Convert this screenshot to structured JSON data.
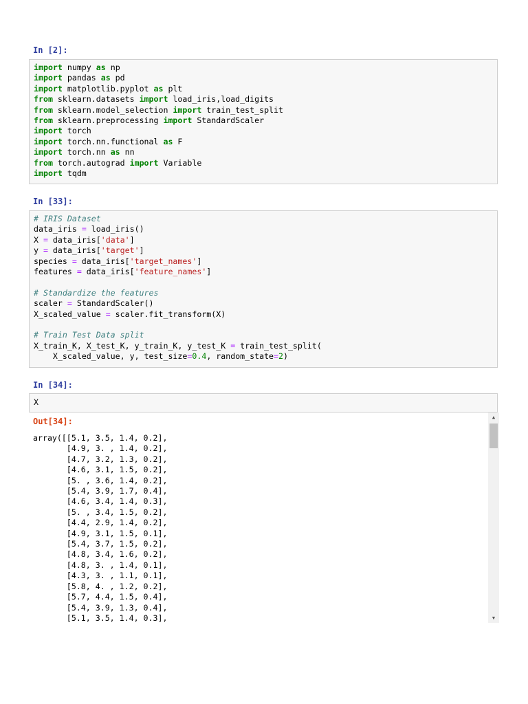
{
  "cells": [
    {
      "prompt": "In [2]:",
      "lines": [
        [
          {
            "t": "import",
            "c": "kw"
          },
          {
            "t": " numpy "
          },
          {
            "t": "as",
            "c": "kw"
          },
          {
            "t": " np"
          }
        ],
        [
          {
            "t": "import",
            "c": "kw"
          },
          {
            "t": " pandas "
          },
          {
            "t": "as",
            "c": "kw"
          },
          {
            "t": " pd"
          }
        ],
        [
          {
            "t": "import",
            "c": "kw"
          },
          {
            "t": " matplotlib.pyplot "
          },
          {
            "t": "as",
            "c": "kw"
          },
          {
            "t": " plt"
          }
        ],
        [
          {
            "t": "from",
            "c": "kw"
          },
          {
            "t": " sklearn.datasets "
          },
          {
            "t": "import",
            "c": "kw"
          },
          {
            "t": " load_iris,load_digits"
          }
        ],
        [
          {
            "t": "from",
            "c": "kw"
          },
          {
            "t": " sklearn.model_selection "
          },
          {
            "t": "import",
            "c": "kw"
          },
          {
            "t": " train_test_split"
          }
        ],
        [
          {
            "t": "from",
            "c": "kw"
          },
          {
            "t": " sklearn.preprocessing "
          },
          {
            "t": "import",
            "c": "kw"
          },
          {
            "t": " StandardScaler"
          }
        ],
        [
          {
            "t": "import",
            "c": "kw"
          },
          {
            "t": " torch"
          }
        ],
        [
          {
            "t": "import",
            "c": "kw"
          },
          {
            "t": " torch.nn.functional "
          },
          {
            "t": "as",
            "c": "kw"
          },
          {
            "t": " F"
          }
        ],
        [
          {
            "t": "import",
            "c": "kw"
          },
          {
            "t": " torch.nn "
          },
          {
            "t": "as",
            "c": "kw"
          },
          {
            "t": " nn"
          }
        ],
        [
          {
            "t": "from",
            "c": "kw"
          },
          {
            "t": " torch.autograd "
          },
          {
            "t": "import",
            "c": "kw"
          },
          {
            "t": " Variable"
          }
        ],
        [
          {
            "t": "import",
            "c": "kw"
          },
          {
            "t": " tqdm"
          }
        ]
      ]
    },
    {
      "prompt": "In [33]:",
      "lines": [
        [
          {
            "t": "# IRIS Dataset",
            "c": "cm"
          }
        ],
        [
          {
            "t": "data_iris "
          },
          {
            "t": "=",
            "c": "op"
          },
          {
            "t": " load_iris()"
          }
        ],
        [
          {
            "t": "X "
          },
          {
            "t": "=",
            "c": "op"
          },
          {
            "t": " data_iris["
          },
          {
            "t": "'data'",
            "c": "str"
          },
          {
            "t": "]"
          }
        ],
        [
          {
            "t": "y "
          },
          {
            "t": "=",
            "c": "op"
          },
          {
            "t": " data_iris["
          },
          {
            "t": "'target'",
            "c": "str"
          },
          {
            "t": "]"
          }
        ],
        [
          {
            "t": "species "
          },
          {
            "t": "=",
            "c": "op"
          },
          {
            "t": " data_iris["
          },
          {
            "t": "'target_names'",
            "c": "str"
          },
          {
            "t": "]"
          }
        ],
        [
          {
            "t": "features "
          },
          {
            "t": "=",
            "c": "op"
          },
          {
            "t": " data_iris["
          },
          {
            "t": "'feature_names'",
            "c": "str"
          },
          {
            "t": "]"
          }
        ],
        [
          {
            "t": ""
          }
        ],
        [
          {
            "t": "# Standardize the features",
            "c": "cm"
          }
        ],
        [
          {
            "t": "scaler "
          },
          {
            "t": "=",
            "c": "op"
          },
          {
            "t": " StandardScaler()"
          }
        ],
        [
          {
            "t": "X_scaled_value "
          },
          {
            "t": "=",
            "c": "op"
          },
          {
            "t": " scaler.fit_transform(X)"
          }
        ],
        [
          {
            "t": ""
          }
        ],
        [
          {
            "t": "# Train Test Data split",
            "c": "cm"
          }
        ],
        [
          {
            "t": "X_train_K, X_test_K, y_train_K, y_test_K "
          },
          {
            "t": "=",
            "c": "op"
          },
          {
            "t": " train_test_split("
          }
        ],
        [
          {
            "t": "    X_scaled_value, y, test_size"
          },
          {
            "t": "=",
            "c": "op"
          },
          {
            "t": "0.4",
            "c": "num"
          },
          {
            "t": ", random_state"
          },
          {
            "t": "=",
            "c": "op"
          },
          {
            "t": "2",
            "c": "num"
          },
          {
            "t": ")"
          }
        ]
      ]
    },
    {
      "prompt": "In [34]:",
      "lines": [
        [
          {
            "t": "X"
          }
        ]
      ]
    }
  ],
  "output": {
    "prompt": "Out[34]:",
    "text": "array([[5.1, 3.5, 1.4, 0.2],\n       [4.9, 3. , 1.4, 0.2],\n       [4.7, 3.2, 1.3, 0.2],\n       [4.6, 3.1, 1.5, 0.2],\n       [5. , 3.6, 1.4, 0.2],\n       [5.4, 3.9, 1.7, 0.4],\n       [4.6, 3.4, 1.4, 0.3],\n       [5. , 3.4, 1.5, 0.2],\n       [4.4, 2.9, 1.4, 0.2],\n       [4.9, 3.1, 1.5, 0.1],\n       [5.4, 3.7, 1.5, 0.2],\n       [4.8, 3.4, 1.6, 0.2],\n       [4.8, 3. , 1.4, 0.1],\n       [4.3, 3. , 1.1, 0.1],\n       [5.8, 4. , 1.2, 0.2],\n       [5.7, 4.4, 1.5, 0.4],\n       [5.4, 3.9, 1.3, 0.4],\n       [5.1, 3.5, 1.4, 0.3],"
  },
  "scrollbar": {
    "up_icon": "scroll-up-arrow-icon",
    "down_icon": "scroll-down-arrow-icon"
  },
  "colors": {
    "keyword": "#008000",
    "string": "#ba2121",
    "comment": "#408080",
    "operator": "#aa22ff",
    "in_prompt": "#303f9f",
    "out_prompt": "#d84315"
  }
}
